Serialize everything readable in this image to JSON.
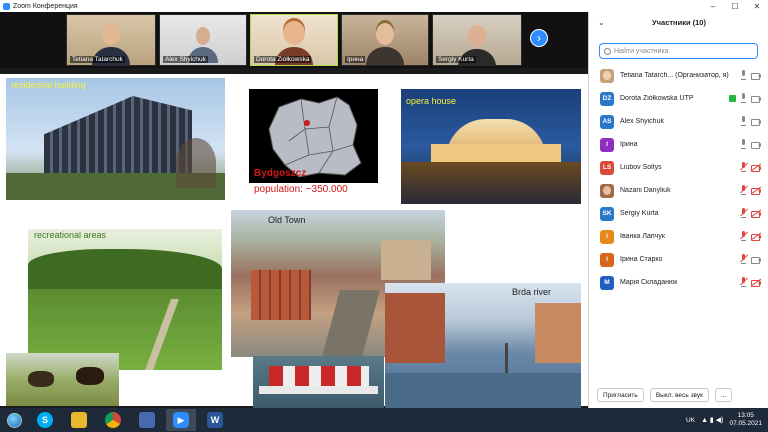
{
  "window": {
    "title": "Zoom Конференция",
    "controls": [
      "–",
      "☐",
      "✕"
    ]
  },
  "video_strip": {
    "tiles": [
      {
        "name": "Tetiana Tatarchuk"
      },
      {
        "name": "Alex Shyichuk"
      },
      {
        "name": "Dorota Ziółkowska"
      },
      {
        "name": "Ірина"
      },
      {
        "name": "Sergiy Kurta"
      }
    ],
    "next_icon": "chevron-right-icon"
  },
  "slide": {
    "residential": "residential building",
    "city": "Bydgoszcz",
    "population": "population: ~350.000",
    "opera": "opera house",
    "recreational": "recreational areas",
    "old_town": "Old Town",
    "river": "Brda river"
  },
  "participants_panel": {
    "title": "Участники (10)",
    "search_placeholder": "Найти участника",
    "participants": [
      {
        "initials": "",
        "name": "Tetiana Tatarch... (Организатор, я)",
        "color": "#c8a07a"
      },
      {
        "initials": "DZ",
        "name": "Dorota Ziółkowska UTP",
        "color": "#2c78c8"
      },
      {
        "initials": "AS",
        "name": "Alex Shyichuk",
        "color": "#2c78c8"
      },
      {
        "initials": "І",
        "name": "Ірина",
        "color": "#8e2fc0"
      },
      {
        "initials": "LS",
        "name": "Liubov Soltys",
        "color": "#d94a3a"
      },
      {
        "initials": "",
        "name": "Nazarii Danyliuk",
        "color": "#a06a4a"
      },
      {
        "initials": "SK",
        "name": "Sergiy Kurta",
        "color": "#2c78c8"
      },
      {
        "initials": "І",
        "name": "Іванка Лапчук",
        "color": "#e8891c"
      },
      {
        "initials": "І",
        "name": "Ірина Старко",
        "color": "#d9651c"
      },
      {
        "initials": "M",
        "name": "Марія Складанюк",
        "color": "#1e5fbf"
      }
    ],
    "buttons": {
      "invite": "Пригласить",
      "mute_all": "Выкл. весь звук",
      "more": "..."
    }
  },
  "taskbar": {
    "apps": [
      "Skype",
      "Explorer",
      "Chrome",
      "Notepad",
      "Zoom",
      "Word"
    ],
    "lang": "UK",
    "time": "13:05",
    "date": "07.05.2021"
  }
}
